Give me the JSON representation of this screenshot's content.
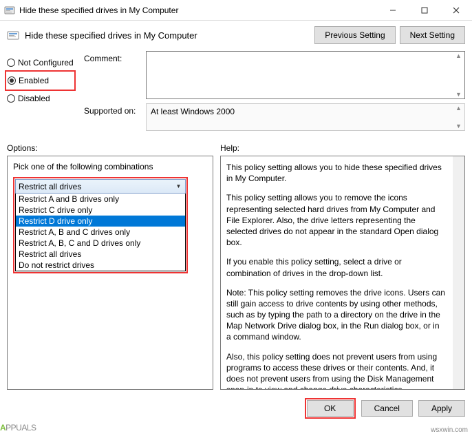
{
  "window": {
    "title": "Hide these specified drives in My Computer"
  },
  "header": {
    "title": "Hide these specified drives in My Computer",
    "prev_btn": "Previous Setting",
    "next_btn": "Next Setting"
  },
  "radios": {
    "not_configured": "Not Configured",
    "enabled": "Enabled",
    "disabled": "Disabled",
    "selected": "enabled"
  },
  "fields": {
    "comment_label": "Comment:",
    "comment_value": "",
    "supported_label": "Supported on:",
    "supported_value": "At least Windows 2000"
  },
  "sections": {
    "options": "Options:",
    "help": "Help:"
  },
  "options_panel": {
    "label": "Pick one of the following combinations",
    "selected": "Restrict all drives",
    "items": [
      "Restrict A and B drives only",
      "Restrict C drive only",
      "Restrict D drive only",
      "Restrict A, B and C drives only",
      "Restrict A, B, C and D drives only",
      "Restrict all drives",
      "Do not restrict drives"
    ],
    "highlighted_index": 2
  },
  "help_panel": {
    "p1": "This policy setting allows you to hide these specified drives in My Computer.",
    "p2": "This policy setting allows you to remove the icons representing selected hard drives from My Computer and File Explorer. Also, the drive letters representing the selected drives do not appear in the standard Open dialog box.",
    "p3": "If you enable this policy setting, select a drive or combination of drives in the drop-down list.",
    "p4": "Note: This policy setting removes the drive icons. Users can still gain access to drive contents by using other methods, such as by typing the path to a directory on the drive in the Map Network Drive dialog box, in the Run dialog box, or in a command window.",
    "p5": "Also, this policy setting does not prevent users from using programs to access these drives or their contents. And, it does not prevent users from using the Disk Management snap-in to view and change drive characteristics."
  },
  "buttons": {
    "ok": "OK",
    "cancel": "Cancel",
    "apply": "Apply"
  },
  "watermark": {
    "brand_prefix": "A",
    "brand_rest": "PPUALS",
    "site": "wsxwin.com"
  }
}
